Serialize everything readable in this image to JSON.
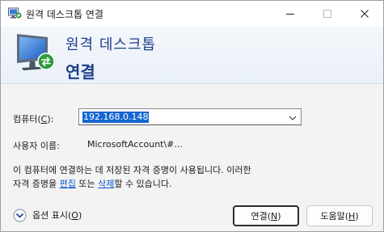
{
  "window": {
    "title": "원격 데스크톱 연결"
  },
  "banner": {
    "line1": "원격 데스크톱",
    "line2": "연결"
  },
  "form": {
    "computer_label_prefix": "컴퓨터(",
    "computer_label_key": "C",
    "computer_label_suffix": "):",
    "computer_value": "192.168.0.148",
    "username_label": "사용자 이름:",
    "username_value": "MicrosoftAccount\\#..."
  },
  "info": {
    "line1": "이 컴퓨터에 연결하는 데 저장된 자격 증명이 사용됩니다. 이러한",
    "line2_prefix": "자격 증명을 ",
    "edit_link": "편집",
    "line2_middle": " 또는 ",
    "delete_link": "삭제",
    "line2_suffix": "할 수 있습니다."
  },
  "footer": {
    "options_prefix": "옵션 표시(",
    "options_key": "O",
    "options_suffix": ")",
    "connect_prefix": "연결(",
    "connect_key": "N",
    "connect_suffix": ")",
    "help_prefix": "도움말(",
    "help_key": "H",
    "help_suffix": ")"
  },
  "icons": {
    "app": "remote-desktop-icon",
    "banner": "remote-desktop-monitor-icon",
    "minimize": "minimize-icon",
    "maximize": "maximize-icon",
    "close": "close-icon",
    "dropdown": "chevron-down-icon",
    "options": "expand-circle-icon"
  },
  "colors": {
    "accent": "#1f3f8c",
    "selection": "#1666d0",
    "link": "#0b57d0"
  }
}
